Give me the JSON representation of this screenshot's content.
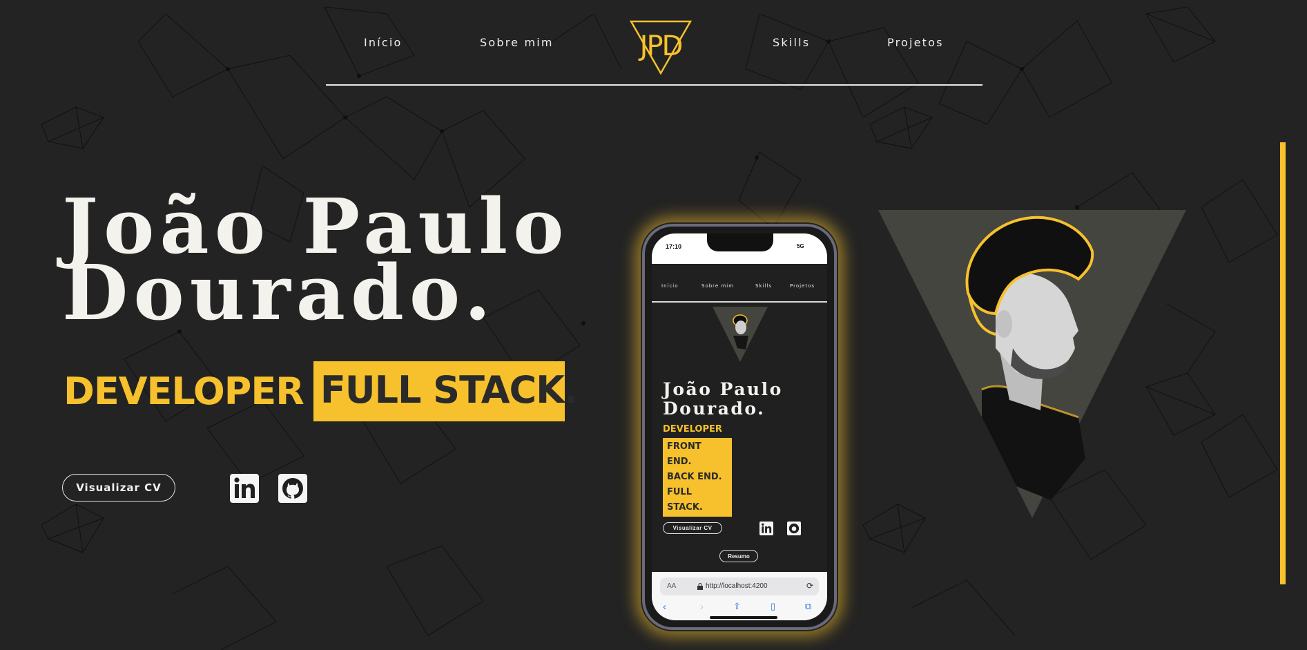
{
  "nav": {
    "items": [
      "Início",
      "Sobre mim",
      "Skills",
      "Projetos"
    ],
    "logo_text": "JPD"
  },
  "hero": {
    "name_line1": "João Paulo",
    "name_line2": "Dourado.",
    "role_prefix": "DEVELOPER",
    "role_highlight": "FULL STACK.",
    "cv_label": "Visualizar CV"
  },
  "social": [
    "linkedin-icon",
    "github-icon"
  ],
  "phone_preview": {
    "time": "17:10",
    "signal": "5G",
    "nav_items": [
      "Início",
      "Sobre mim",
      "Skills",
      "Projetos"
    ],
    "name_line1": "João Paulo",
    "name_line2": "Dourado.",
    "role_prefix": "DEVELOPER",
    "roles": [
      "FRONT END.",
      "BACK END.",
      "FULL STACK."
    ],
    "cv_label": "Visualizar CV",
    "resumo_label": "Resumo",
    "browser": {
      "aa": "AA",
      "url": "http://localhost:4200"
    }
  },
  "colors": {
    "background": "#232323",
    "accent": "#f6c12c",
    "text": "#f2f0ea"
  }
}
